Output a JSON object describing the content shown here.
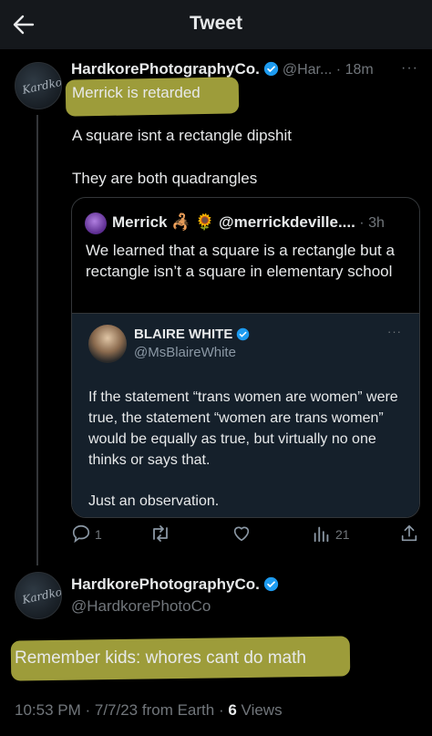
{
  "header": {
    "title": "Tweet"
  },
  "reply_tweet": {
    "author_name": "HardkorePhotographyCo.",
    "handle": "@Har...",
    "time": "18m",
    "line1": "Merrick is retarded",
    "line2": "A square isnt a rectangle dipshit",
    "line3": "They are both quadrangles",
    "avatar_signature": "Kardkore"
  },
  "quote": {
    "author_name": "Merrick",
    "emojis": "🦂 🌻",
    "handle": "@merrickdeville....",
    "time": "3h",
    "text": "We learned that a square is a rectangle but a rectangle isn’t a square in elementary school",
    "nested": {
      "author_name": "BLAIRE WHITE",
      "handle": "@MsBlaireWhite",
      "para1": "If the statement “trans women are women” were true, the statement “women are trans women” would be equally as true, but virtually no one thinks or says that.",
      "para2": "Just an observation."
    }
  },
  "actions": {
    "replies": "1",
    "views": "21"
  },
  "main_tweet": {
    "author_name": "HardkorePhotographyCo.",
    "handle": "@HardkorePhotoCo",
    "text": "Remember kids: whores cant do math",
    "time": "10:53 PM",
    "date": "7/7/23",
    "source": "from Earth",
    "views_count": "6",
    "views_label": "Views",
    "avatar_signature": "Kardkore"
  },
  "colors": {
    "verified": "#1d9bf0",
    "highlight": "#c9c84a",
    "muted": "#71767b"
  }
}
